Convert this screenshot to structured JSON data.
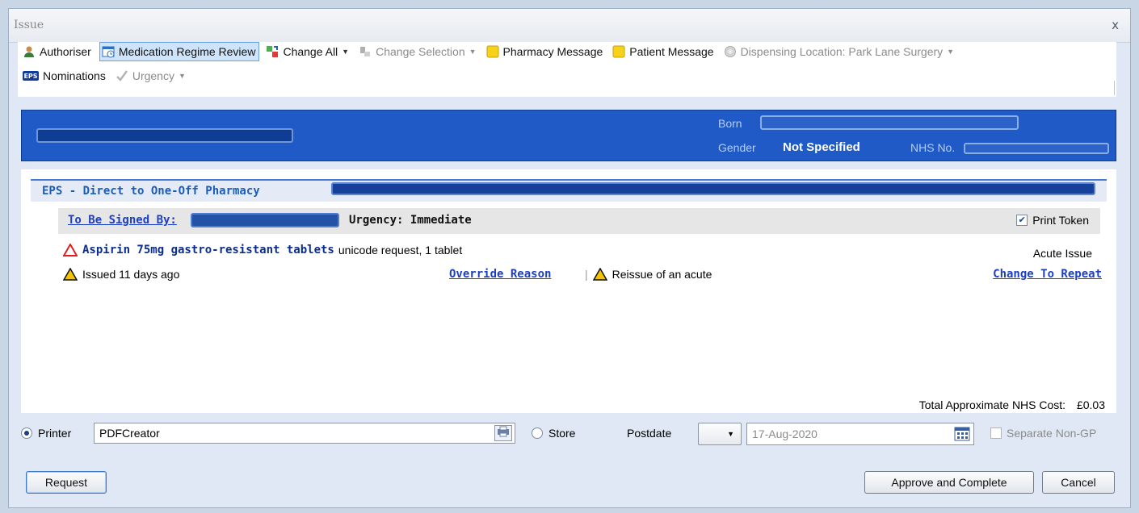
{
  "window": {
    "title": "Issue",
    "close_glyph": "x"
  },
  "toolbar": {
    "authoriser": "Authoriser",
    "medication_regime_review": "Medication Regime Review",
    "change_all": "Change All",
    "change_selection": "Change Selection",
    "pharmacy_message": "Pharmacy Message",
    "patient_message": "Patient Message",
    "dispensing_location": "Dispensing Location: Park Lane Surgery",
    "nominations": "Nominations",
    "urgency": "Urgency",
    "eps_badge": "EPS"
  },
  "patient": {
    "born_label": "Born",
    "gender_label": "Gender",
    "gender_value": "Not Specified",
    "nhs_label": "NHS No."
  },
  "prescription": {
    "eps_title": "EPS - Direct to One-Off Pharmacy",
    "signed_by_label": "To Be Signed By:",
    "urgency": "Urgency: Immediate",
    "print_token_label": "Print Token",
    "print_token_checked": true,
    "medication_name": "Aspirin 75mg gastro-resistant tablets",
    "medication_detail": "unicode request, 1 tablet",
    "issue_type": "Acute Issue",
    "issued_ago": "Issued 11 days ago",
    "override_reason": "Override Reason",
    "reissue_warning": "Reissue of an acute",
    "change_to_repeat": "Change To Repeat",
    "total_cost_label": "Total Approximate NHS Cost:",
    "total_cost_value": "£0.03"
  },
  "output": {
    "printer_label": "Printer",
    "printer_selected": true,
    "printer_value": "PDFCreator",
    "store_label": "Store",
    "postdate_label": "Postdate",
    "postdate_value": "17-Aug-2020",
    "separate_non_gp_label": "Separate Non-GP"
  },
  "buttons": {
    "request": "Request",
    "approve_and_complete": "Approve and Complete",
    "cancel": "Cancel"
  },
  "colors": {
    "banner": "#1f5ac6",
    "link": "#1d3fc4",
    "eps_title": "#1d5cb5",
    "warning_red": "#e02020",
    "warning_yellow": "#f5c400"
  }
}
